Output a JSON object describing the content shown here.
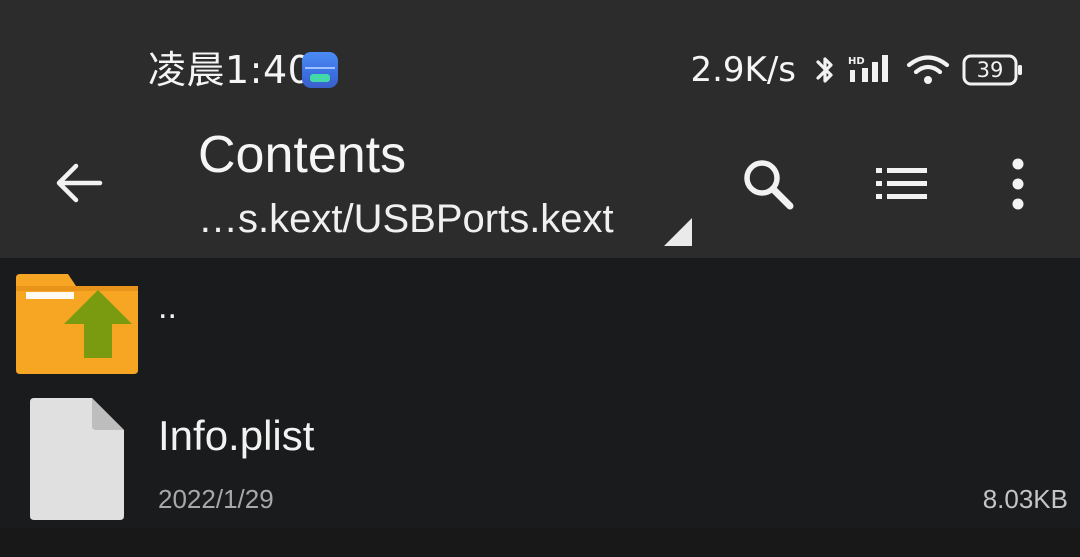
{
  "status_bar": {
    "time": "凌晨1:40",
    "net_speed": "2.9K/s",
    "battery": "39",
    "icons": [
      "app-notification-icon",
      "bluetooth-icon",
      "hd-signal-icon",
      "wifi-icon",
      "battery-icon"
    ]
  },
  "app_bar": {
    "title": "Contents",
    "path": "…s.kext/USBPorts.kext",
    "icons": [
      "back-arrow-icon",
      "search-icon",
      "list-view-icon",
      "more-vert-icon"
    ]
  },
  "files": [
    {
      "name": "..",
      "icon": "folder-up-icon",
      "date": "",
      "size": ""
    },
    {
      "name": "Info.plist",
      "icon": "file-icon",
      "date": "2022/1/29",
      "size": "8.03KB"
    }
  ],
  "colors": {
    "bar_background": "#2c2c2c",
    "list_background": "#1a1b1c",
    "folder": "#f6a623",
    "folder_arrow": "#7a9a10",
    "file": "#e0e0e0"
  }
}
